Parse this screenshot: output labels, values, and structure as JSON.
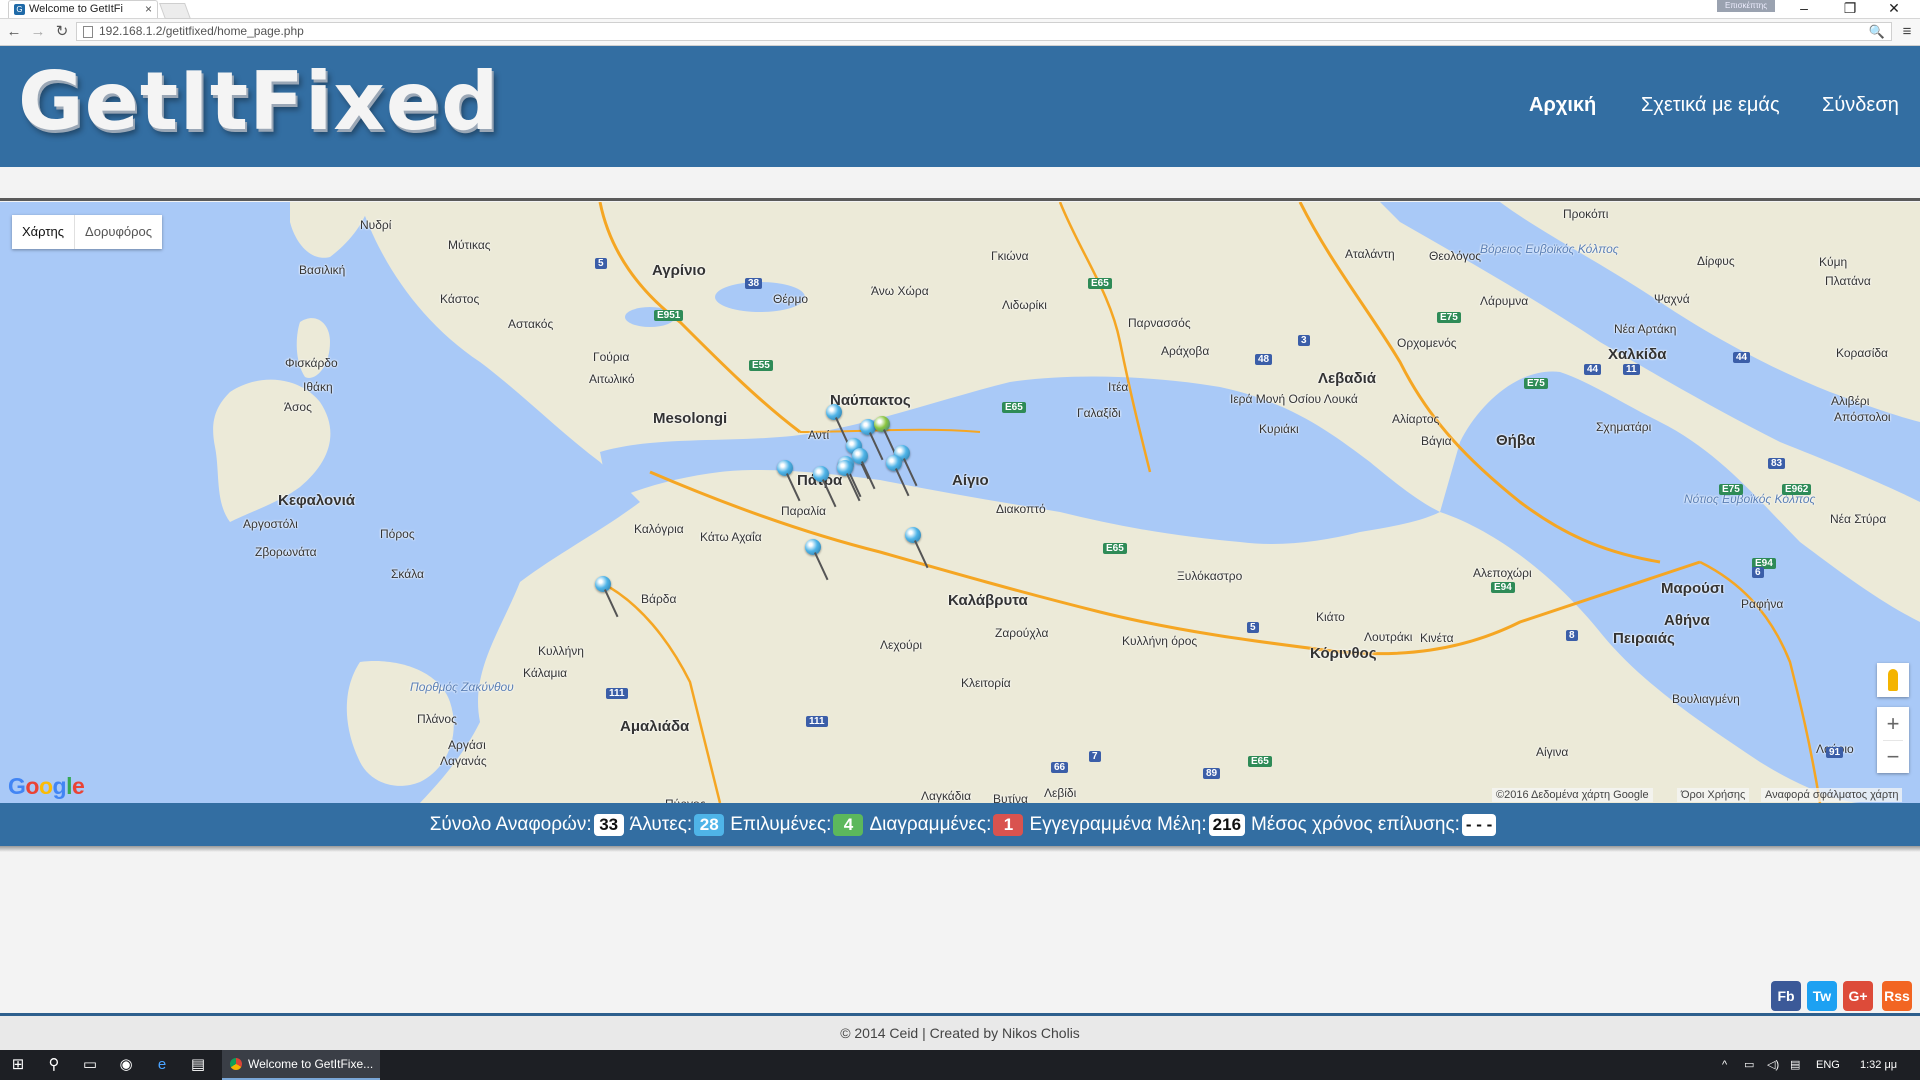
{
  "browser": {
    "tab_title": "Welcome to GetItFi",
    "tab_close": "×",
    "window_label": "Επισκέπτης",
    "url": "192.168.1.2/getitfixed/home_page.php"
  },
  "header": {
    "logo": "GetItFixed",
    "nav": [
      "Αρχική",
      "Σχετικά με εμάς",
      "Σύνδεση"
    ]
  },
  "map": {
    "type_buttons": [
      "Χάρτης",
      "Δορυφόρος"
    ],
    "active_type": "Χάρτης",
    "attribution": "©2016 Δεδομένα χάρτη Google",
    "terms": "Όροι Χρήσης",
    "report_error": "Αναφορά σφάλματος χάρτη",
    "places": [
      {
        "name": "Νυδρί"
      },
      {
        "name": "Μύτικας"
      },
      {
        "name": "Αγρίνιο"
      },
      {
        "name": "Θέρμο"
      },
      {
        "name": "Άνω Χώρα"
      },
      {
        "name": "Γκιώνα"
      },
      {
        "name": "Λιδωρίκι"
      },
      {
        "name": "Παρνασσός"
      },
      {
        "name": "Αράχοβα"
      },
      {
        "name": "Αταλάντη"
      },
      {
        "name": "Θεολόγος"
      },
      {
        "name": "Προκόπι"
      },
      {
        "name": "Δίρφυς"
      },
      {
        "name": "Κύμη"
      },
      {
        "name": "Πλατάνα"
      },
      {
        "name": "Ψαχνά"
      },
      {
        "name": "Λάρυμνα"
      },
      {
        "name": "Νέα Αρτάκη"
      },
      {
        "name": "Χαλκίδα"
      },
      {
        "name": "Κορασίδα"
      },
      {
        "name": "Αλιβέρι"
      },
      {
        "name": "Απόστολοι"
      },
      {
        "name": "Ορχομενός"
      },
      {
        "name": "Λεβαδιά"
      },
      {
        "name": "Αλίαρτος"
      },
      {
        "name": "Βάγια"
      },
      {
        "name": "Θήβα"
      },
      {
        "name": "Σχηματάρι"
      },
      {
        "name": "Ιερά Μονή Οσίου Λουκά"
      },
      {
        "name": "Κυριάκι"
      },
      {
        "name": "Ιτέα"
      },
      {
        "name": "Γαλαξίδι"
      },
      {
        "name": "Βασιλική"
      },
      {
        "name": "Κάστος"
      },
      {
        "name": "Αστακός"
      },
      {
        "name": "Γούρια"
      },
      {
        "name": "Αιτωλικό"
      },
      {
        "name": "Mesolongi"
      },
      {
        "name": "Φισκάρδο"
      },
      {
        "name": "Ιθάκη"
      },
      {
        "name": "Άσος"
      },
      {
        "name": "Κεφαλονιά"
      },
      {
        "name": "Αργοστόλι"
      },
      {
        "name": "Πόρος"
      },
      {
        "name": "Σκάλα"
      },
      {
        "name": "Ζβορωνάτα"
      },
      {
        "name": "Ναύπακτος"
      },
      {
        "name": "Αντί"
      },
      {
        "name": "Πάτρα"
      },
      {
        "name": "Παραλία"
      },
      {
        "name": "Καλόγρια"
      },
      {
        "name": "Κάτω Αχαΐα"
      },
      {
        "name": "Αίγιο"
      },
      {
        "name": "Διακοπτό"
      },
      {
        "name": "Βάρδα"
      },
      {
        "name": "Κυλλήνη"
      },
      {
        "name": "Κάλαμια"
      },
      {
        "name": "Καλάβρυτα"
      },
      {
        "name": "Λεχούρι"
      },
      {
        "name": "Ζαρούχλα"
      },
      {
        "name": "Κλειτορία"
      },
      {
        "name": "Κυλλήνη όρος"
      },
      {
        "name": "Ξυλόκαστρο"
      },
      {
        "name": "Κιάτο"
      },
      {
        "name": "Κόρινθος"
      },
      {
        "name": "Λουτράκι"
      },
      {
        "name": "Κινέτα"
      },
      {
        "name": "Αλεποχώρι"
      },
      {
        "name": "Μαρούσι"
      },
      {
        "name": "Αθήνα"
      },
      {
        "name": "Ραφήνα"
      },
      {
        "name": "Πειραιάς"
      },
      {
        "name": "Βουλιαγμένη"
      },
      {
        "name": "Αίγινα"
      },
      {
        "name": "Λαύριο"
      },
      {
        "name": "Αμαλιάδα"
      },
      {
        "name": "Πλάνος"
      },
      {
        "name": "Αργάσι"
      },
      {
        "name": "Λαγανάς"
      },
      {
        "name": "Πύργος"
      },
      {
        "name": "Λαγκάδια"
      },
      {
        "name": "Βυτίνα"
      },
      {
        "name": "Λεβίδι"
      },
      {
        "name": "Πορθμός Ζακύνθου"
      },
      {
        "name": "Νότιος Ευβοϊκός Κόλπος"
      },
      {
        "name": "Βόρειος Ευβοϊκός Κόλπος"
      },
      {
        "name": "Νέα Στύρα"
      }
    ],
    "road_shields": [
      "5",
      "38",
      "E951",
      "E65",
      "E75",
      "3",
      "48",
      "44",
      "11",
      "44",
      "E75",
      "E962",
      "83",
      "E75",
      "E94",
      "6",
      "E94",
      "8",
      "E65",
      "E65",
      "5",
      "E55",
      "111",
      "111",
      "66",
      "7",
      "E65",
      "89",
      "91"
    ]
  },
  "stats": {
    "total_label": "Σύνολο Αναφορών:",
    "total": "33",
    "unsolved_label": "Άλυτες:",
    "unsolved": "28",
    "solved_label": "Επιλυμένες:",
    "solved": "4",
    "deleted_label": "Διαγραμμένες:",
    "deleted": "1",
    "members_label": "Εγγεγραμμένα Μέλη:",
    "members": "216",
    "avg_label": "Μέσος χρόνος επίλυσης:",
    "avg": "- - -"
  },
  "social": [
    "Fb",
    "Tw",
    "G+",
    "Rss"
  ],
  "footer": "© 2014 Ceid | Created by Nikos Cholis",
  "taskbar": {
    "app_label": "Welcome to GetItFixe...",
    "language": "ENG",
    "time": "1:32 μμ"
  },
  "colors": {
    "brand": "#336ea2",
    "water": "#a9c9f7",
    "land": "#ecead8",
    "pin_blue": "#4fb4e8",
    "pin_green": "#8bc53f"
  }
}
